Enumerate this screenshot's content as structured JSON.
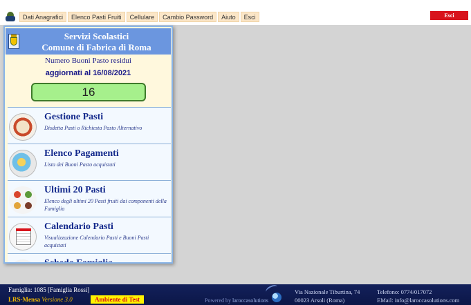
{
  "menu": {
    "items": [
      "Dati Anagrafici",
      "Elenco Pasti Fruiti",
      "Cellulare",
      "Cambio Password",
      "Aiuto",
      "Esci"
    ],
    "exit_label": "Esci"
  },
  "panel": {
    "title_line1": "Servizi Scolastici",
    "title_line2": "Comune di Fabrica di Roma",
    "subtitle": "Numero Buoni Pasto residui",
    "updated": "aggiornati al 16/08/2021",
    "count": "16",
    "entries": [
      {
        "title": "Gestione Pasti",
        "desc": "Disdetta Pasti o Richiesta Pasto Alternativo",
        "icon": "meal-plate-icon"
      },
      {
        "title": "Elenco Pagamenti",
        "desc": "Lista dei Buoni Pasto acquistati",
        "icon": "payments-icon"
      },
      {
        "title": "Ultimi 20 Pasti",
        "desc": "Elenco degli ultimi 20 Pasti fruiti dai componenti della Famiglia",
        "icon": "meals-grid-icon"
      },
      {
        "title": "Calendario Pasti",
        "desc": "Visualizzazione Calendario Pasti e Buoni Pasti acquistati",
        "icon": "calendar-icon"
      },
      {
        "title": "Scheda Famiglia",
        "desc": "",
        "icon": "family-icon"
      }
    ]
  },
  "footer": {
    "famiglia": "Famiglia: 1085 [Famiglia Rossi]",
    "app_name": "LRS-Mensa",
    "version": "Versione 3.0",
    "environment": "Ambiente di Test",
    "powered_prefix": "Powered by",
    "powered_brand": "laroccasolutions",
    "address1": "Via Nazionale Tiburtina, 74",
    "address2": "00023 Arsoli (Roma)",
    "phone": "Telefono: 0774/017072",
    "email": "EMail: info@laroccasolutions.com"
  },
  "colors": {
    "header_blue": "#6b96df",
    "exit_red": "#d8141c",
    "counter_green": "#a6f08c",
    "footer_navy": "#13205a"
  }
}
